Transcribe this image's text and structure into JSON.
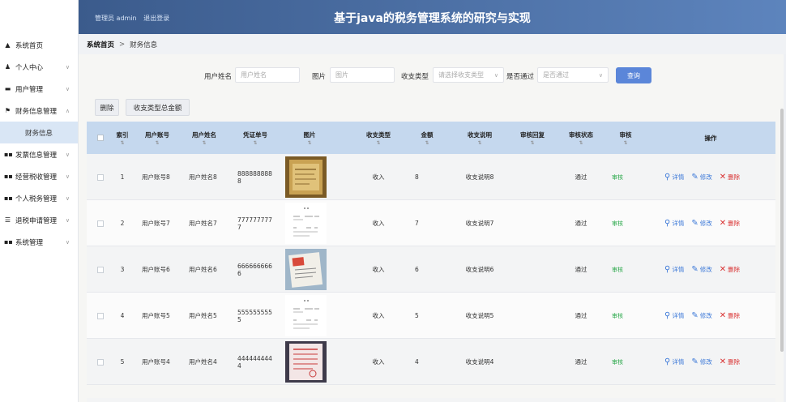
{
  "header": {
    "user_prefix": "管理员 admin",
    "logout": "退出登录",
    "title": "基于java的税务管理系统的研究与实现"
  },
  "sidebar": {
    "items": [
      {
        "label": "系统首页",
        "icon": "home-icon",
        "glyph": "▲",
        "chevron": false
      },
      {
        "label": "个人中心",
        "icon": "user-icon",
        "glyph": "♟",
        "chevron": true
      },
      {
        "label": "用户管理",
        "icon": "users-icon",
        "glyph": "▬",
        "chevron": true
      },
      {
        "label": "财务信息管理",
        "icon": "flag-icon",
        "glyph": "⚑",
        "chevron": true,
        "open": true
      },
      {
        "label": "财务信息",
        "sub": true
      },
      {
        "label": "发票信息管理",
        "icon": "grid-icon",
        "glyph": "▪▪",
        "chevron": true
      },
      {
        "label": "经营税收管理",
        "icon": "grid-icon",
        "glyph": "▪▪",
        "chevron": true
      },
      {
        "label": "个人税务管理",
        "icon": "grid-icon",
        "glyph": "▪▪",
        "chevron": true
      },
      {
        "label": "退税申请管理",
        "icon": "list-icon",
        "glyph": "☰",
        "chevron": true
      },
      {
        "label": "系统管理",
        "icon": "grid-icon",
        "glyph": "▪▪",
        "chevron": true
      }
    ]
  },
  "breadcrumb": {
    "home": "系统首页",
    "sep": ">",
    "current": "财务信息"
  },
  "search": {
    "username_label": "用户姓名",
    "username_placeholder": "用户姓名",
    "image_label": "图片",
    "image_placeholder": "图片",
    "type_label": "收支类型",
    "type_placeholder": "请选择收支类型",
    "pass_label": "是否通过",
    "pass_placeholder": "是否通过",
    "search_button": "查询"
  },
  "buttons": {
    "delete": "删除",
    "total": "收支类型总金额"
  },
  "table": {
    "columns": {
      "index": "索引",
      "account": "用户账号",
      "name": "用户姓名",
      "voucher": "凭证单号",
      "image": "图片",
      "type": "收支类型",
      "amount": "金额",
      "desc": "收支说明",
      "reply": "审核回复",
      "status": "审核状态",
      "audit": "审核",
      "ops": "操作"
    },
    "rows": [
      {
        "index": "1",
        "account": "用户账号8",
        "name": "用户姓名8",
        "voucher": "888888888 8",
        "type": "收入",
        "amount": "8",
        "desc": "收支说明8",
        "status": "通过",
        "audit": "审核",
        "thumb": "wood"
      },
      {
        "index": "2",
        "account": "用户账号7",
        "name": "用户姓名7",
        "voucher": "777777777 7",
        "type": "收入",
        "amount": "7",
        "desc": "收支说明7",
        "status": "通过",
        "audit": "审核",
        "thumb": "doc"
      },
      {
        "index": "3",
        "account": "用户账号6",
        "name": "用户姓名6",
        "voucher": "666666666 6",
        "type": "收入",
        "amount": "6",
        "desc": "收支说明6",
        "status": "通过",
        "audit": "审核",
        "thumb": "photo"
      },
      {
        "index": "4",
        "account": "用户账号5",
        "name": "用户姓名5",
        "voucher": "555555555 5",
        "type": "收入",
        "amount": "5",
        "desc": "收支说明5",
        "status": "通过",
        "audit": "审核",
        "thumb": "doc"
      },
      {
        "index": "5",
        "account": "用户账号4",
        "name": "用户姓名4",
        "voucher": "444444444 4",
        "type": "收入",
        "amount": "4",
        "desc": "收支说明4",
        "status": "通过",
        "audit": "审核",
        "thumb": "red"
      }
    ],
    "actions": {
      "detail": "详情",
      "edit": "修改",
      "delete": "删除"
    }
  },
  "colors": {
    "header": "#4a6fa5",
    "accent": "#5b86d9",
    "delete": "#d93232",
    "ok": "#2aa84a"
  }
}
